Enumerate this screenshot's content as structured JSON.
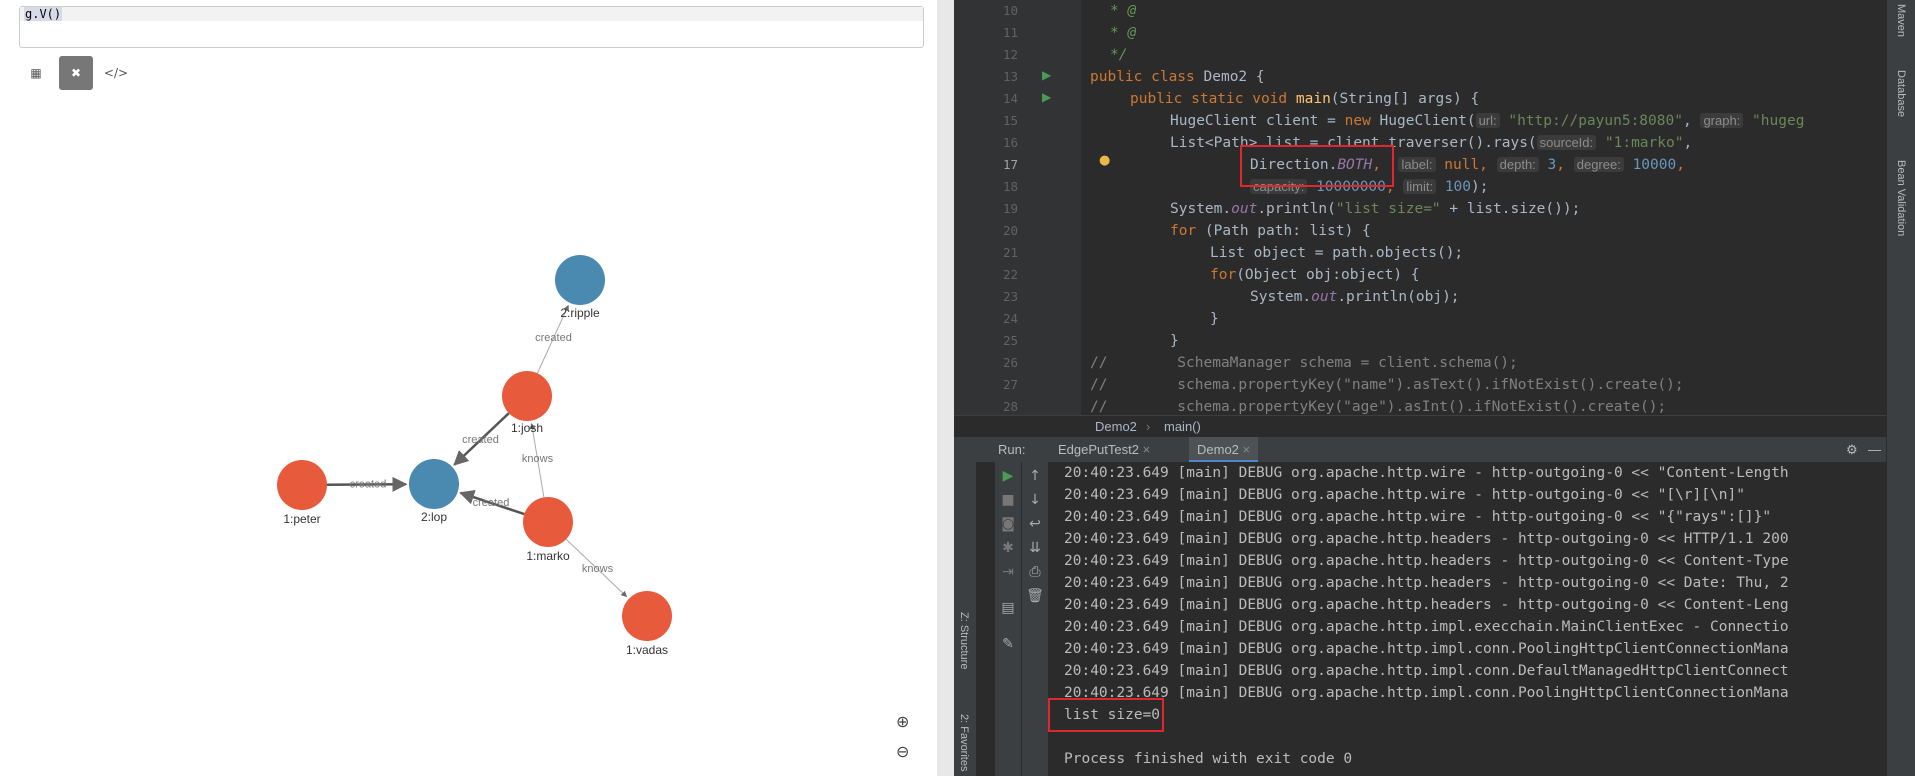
{
  "left": {
    "query": "g.V()",
    "toolbar": {
      "table_icon": "▦",
      "graph_icon": "✖",
      "code_icon": "</>"
    },
    "graph": {
      "nodes": [
        {
          "id": "ripple",
          "label": "2:ripple",
          "color": "#4a8ab0"
        },
        {
          "id": "josh",
          "label": "1:josh",
          "color": "#e85a3c"
        },
        {
          "id": "peter",
          "label": "1:peter",
          "color": "#e85a3c"
        },
        {
          "id": "lop",
          "label": "2:lop",
          "color": "#4a8ab0"
        },
        {
          "id": "marko",
          "label": "1:marko",
          "color": "#e85a3c"
        },
        {
          "id": "vadas",
          "label": "1:vadas",
          "color": "#e85a3c"
        }
      ],
      "edges": [
        {
          "from": "josh",
          "to": "ripple",
          "label": "created"
        },
        {
          "from": "josh",
          "to": "lop",
          "label": "created"
        },
        {
          "from": "peter",
          "to": "lop",
          "label": "created"
        },
        {
          "from": "marko",
          "to": "lop",
          "label": "created"
        },
        {
          "from": "marko",
          "to": "josh",
          "label": "knows"
        },
        {
          "from": "marko",
          "to": "vadas",
          "label": "knows"
        }
      ]
    },
    "zoom_in": "⊕",
    "zoom_out": "⊖"
  },
  "ide": {
    "line_numbers": [
      "10",
      "11",
      "12",
      "13",
      "14",
      "15",
      "16",
      "17",
      "18",
      "19",
      "20",
      "21",
      "22",
      "23",
      "24",
      "25",
      "26",
      "27",
      "28"
    ],
    "code": {
      "l13_public": "public class ",
      "l13_name": "Demo2 {",
      "l14_kw": "public static void ",
      "l14_fn": "main",
      "l14_rest": "(String[] args) {",
      "l15_a": "HugeClient client = ",
      "l15_new": "new ",
      "l15_b": "HugeClient(",
      "l15_hint1": "url:",
      "l15_str": "\"http://payun5:8080\"",
      "l15_c": ", ",
      "l15_hint2": "graph:",
      "l15_str2": "\"hugeg",
      "l16_a": "List<Path> list = client.traverser().rays(",
      "l16_hint": "sourceId:",
      "l16_str": "\"1:marko\"",
      "l16_c": ",",
      "l17_a": "Direction.",
      "l17_both": "BOTH",
      "l17_c": ",",
      "l17_h1": "label:",
      "l17_null": "null",
      "l17_h2": "depth:",
      "l17_v2": "3",
      "l17_h3": "degree:",
      "l17_v3": "10000",
      "l18_h1": "capacity:",
      "l18_v1": "10000000",
      "l18_h2": "limit:",
      "l18_v2": "100",
      "l18_end": ");",
      "l19_a": "System.",
      "l19_out": "out",
      "l19_b": ".println(",
      "l19_str": "\"list size=\"",
      "l19_c": " + list.size());",
      "l20_for": "for ",
      "l20_rest": "(Path path: list) {",
      "l21": "List object = path.objects();",
      "l22_for": "for",
      "l22_rest": "(Object obj:object) {",
      "l23_a": "System.",
      "l23_out": "out",
      "l23_b": ".println(obj);",
      "l24": "}",
      "l25": "}",
      "l26": "//        SchemaManager schema = client.schema();",
      "l27": "//        schema.propertyKey(\"name\").asText().ifNotExist().create();",
      "l28": "//        schema.propertyKey(\"age\").asInt().ifNotExist().create();",
      "l10": "* @",
      "l11": "* @",
      "l12": "*/"
    },
    "breadcrumb": [
      "Demo2",
      "main()"
    ],
    "run": {
      "label": "Run:",
      "tabs": [
        "EdgePutTest2",
        "Demo2"
      ],
      "settings_icon": "⚙",
      "minimize_icon": "—"
    },
    "right_tools": [
      "Maven",
      "Database",
      "Bean Validation"
    ],
    "left_tools": [
      "Z: Structure",
      "2: Favorites"
    ],
    "console": [
      "20:40:23.649 [main] DEBUG org.apache.http.wire - http-outgoing-0 << \"Content-Length",
      "20:40:23.649 [main] DEBUG org.apache.http.wire - http-outgoing-0 << \"[\\r][\\n]\"",
      "20:40:23.649 [main] DEBUG org.apache.http.wire - http-outgoing-0 << \"{\"rays\":[]}\"",
      "20:40:23.649 [main] DEBUG org.apache.http.headers - http-outgoing-0 << HTTP/1.1 200",
      "20:40:23.649 [main] DEBUG org.apache.http.headers - http-outgoing-0 << Content-Type",
      "20:40:23.649 [main] DEBUG org.apache.http.headers - http-outgoing-0 << Date: Thu, 2",
      "20:40:23.649 [main] DEBUG org.apache.http.headers - http-outgoing-0 << Content-Leng",
      "20:40:23.649 [main] DEBUG org.apache.http.impl.execchain.MainClientExec - Connectio",
      "20:40:23.649 [main] DEBUG org.apache.http.impl.conn.PoolingHttpClientConnectionMana",
      "20:40:23.649 [main] DEBUG org.apache.http.impl.conn.DefaultManagedHttpClientConnect",
      "20:40:23.649 [main] DEBUG org.apache.http.impl.conn.PoolingHttpClientConnectionMana",
      "list size=0",
      "",
      "Process finished with exit code 0"
    ]
  }
}
